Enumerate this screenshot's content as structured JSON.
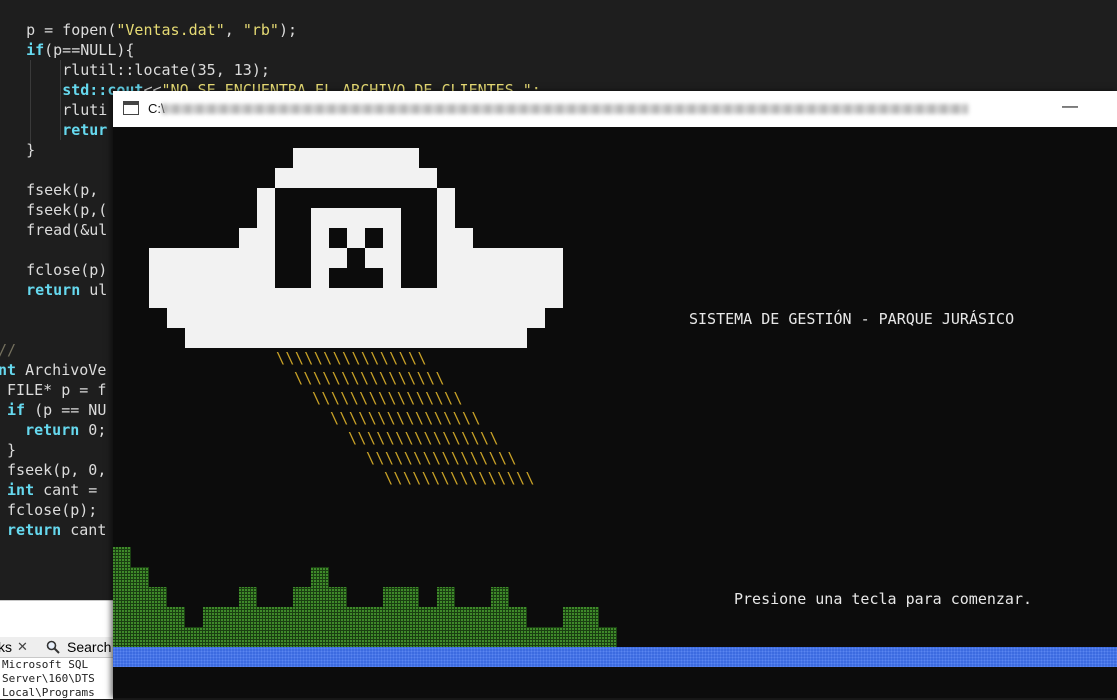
{
  "editor": {
    "lines": [
      {
        "indent": "  ",
        "parts": [
          {
            "t": "p = fopen(",
            "c": ""
          },
          {
            "t": "\"Ventas.dat\"",
            "c": "tok-str"
          },
          {
            "t": ", ",
            "c": ""
          },
          {
            "t": "\"rb\"",
            "c": "tok-str"
          },
          {
            "t": ");",
            "c": ""
          }
        ]
      },
      {
        "indent": "  ",
        "parts": [
          {
            "t": "if",
            "c": "tok-kw"
          },
          {
            "t": "(p==NULL){",
            "c": ""
          }
        ]
      },
      {
        "indent": "      ",
        "parts": [
          {
            "t": "rlutil::locate(35, 13);",
            "c": ""
          }
        ]
      },
      {
        "indent": "      ",
        "parts": [
          {
            "t": "std::cout",
            "c": "tok-kw"
          },
          {
            "t": "<<",
            "c": ""
          },
          {
            "t": "\"NO SE ENCUENTRA EL ARCHIVO DE CLIENTES \";",
            "c": "tok-str"
          }
        ]
      },
      {
        "indent": "      ",
        "parts": [
          {
            "t": "rluti",
            "c": ""
          }
        ]
      },
      {
        "indent": "      ",
        "parts": [
          {
            "t": "retur",
            "c": "tok-kw"
          }
        ]
      },
      {
        "indent": "  ",
        "parts": [
          {
            "t": "}",
            "c": ""
          }
        ]
      },
      {
        "indent": "",
        "parts": []
      },
      {
        "indent": "  ",
        "parts": [
          {
            "t": "fseek(p,",
            "c": ""
          }
        ]
      },
      {
        "indent": "  ",
        "parts": [
          {
            "t": "fseek(p,(",
            "c": ""
          }
        ]
      },
      {
        "indent": "  ",
        "parts": [
          {
            "t": "fread(&ul",
            "c": ""
          }
        ]
      },
      {
        "indent": "",
        "parts": []
      },
      {
        "indent": "  ",
        "parts": [
          {
            "t": "fclose(p)",
            "c": ""
          }
        ]
      },
      {
        "indent": "  ",
        "parts": [
          {
            "t": "return",
            "c": "tok-kw"
          },
          {
            "t": " ul",
            "c": ""
          }
        ]
      },
      {
        "indent": "",
        "parts": []
      },
      {
        "indent": "",
        "parts": []
      },
      {
        "indent": "",
        "parts": [
          {
            "t": "//",
            "c": "tok-cm"
          }
        ]
      },
      {
        "indent": "",
        "parts": [
          {
            "t": "nt",
            "c": "tok-kw"
          },
          {
            "t": " ArchivoVe",
            "c": ""
          }
        ]
      },
      {
        "indent": " ",
        "parts": [
          {
            "t": "FILE* p = f",
            "c": ""
          }
        ]
      },
      {
        "indent": " ",
        "parts": [
          {
            "t": "if",
            "c": "tok-kw"
          },
          {
            "t": " (p == NU",
            "c": ""
          }
        ]
      },
      {
        "indent": "   ",
        "parts": [
          {
            "t": "return",
            "c": "tok-kw"
          },
          {
            "t": " 0;",
            "c": ""
          }
        ]
      },
      {
        "indent": " ",
        "parts": [
          {
            "t": "}",
            "c": ""
          }
        ]
      },
      {
        "indent": " ",
        "parts": [
          {
            "t": "fseek(p, 0,",
            "c": ""
          }
        ]
      },
      {
        "indent": " ",
        "parts": [
          {
            "t": "int",
            "c": "tok-kw"
          },
          {
            "t": " cant = ",
            "c": ""
          }
        ]
      },
      {
        "indent": " ",
        "parts": [
          {
            "t": "fclose(p);",
            "c": ""
          }
        ]
      },
      {
        "indent": " ",
        "parts": [
          {
            "t": "return",
            "c": "tok-kw"
          },
          {
            "t": " cant",
            "c": ""
          }
        ]
      }
    ]
  },
  "ide_panel": {
    "tab_fragment": "ks",
    "tab_close": "✕",
    "search_label": "Search",
    "output_lines": [
      "Microsoft SQL",
      "Server\\160\\DTS",
      "Local\\Programs"
    ]
  },
  "console": {
    "title_prefix": "C:\\",
    "minimize_glyph": "—",
    "heading": "SISTEMA DE GESTIÓN - PARQUE JURÁSICO",
    "prompt": "Presione una tecla para comenzar.",
    "beam_rows": [
      "\\\\\\\\\\\\\\\\\\\\\\\\\\\\\\\\",
      "\\\\\\\\\\\\\\\\\\\\\\\\\\\\\\\\",
      "\\\\\\\\\\\\\\\\\\\\\\\\\\\\\\\\",
      "\\\\\\\\\\\\\\\\\\\\\\\\\\\\\\\\",
      "\\\\\\\\\\\\\\\\\\\\\\\\\\\\\\\\",
      "\\\\\\\\\\\\\\\\\\\\\\\\\\\\\\\\",
      "\\\\\\\\\\\\\\\\\\\\\\\\\\\\\\\\"
    ]
  },
  "colors": {
    "console_bg": "#0c0c0c",
    "ufo_white": "#f2f2f2",
    "beam_yellow": "#c9a227",
    "ground_green": "#2e6b1f",
    "water_blue": "#3c6be0",
    "text": "#e8e8e8"
  }
}
